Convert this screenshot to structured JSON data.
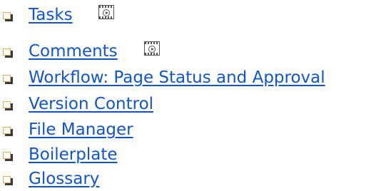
{
  "feature_list": {
    "items": [
      {
        "label": "Tasks",
        "has_video": true
      },
      {
        "label": "Comments",
        "has_video": true
      },
      {
        "label": "Workflow: Page Status and Approval",
        "has_video": false
      },
      {
        "label": "Version Control",
        "has_video": false
      },
      {
        "label": "File Manager",
        "has_video": false
      },
      {
        "label": "Boilerplate",
        "has_video": false
      },
      {
        "label": "Glossary",
        "has_video": false
      }
    ],
    "link_color": "#1155cc",
    "bullet_color": "#e0b34a",
    "video_icon_name": "video-icon"
  }
}
